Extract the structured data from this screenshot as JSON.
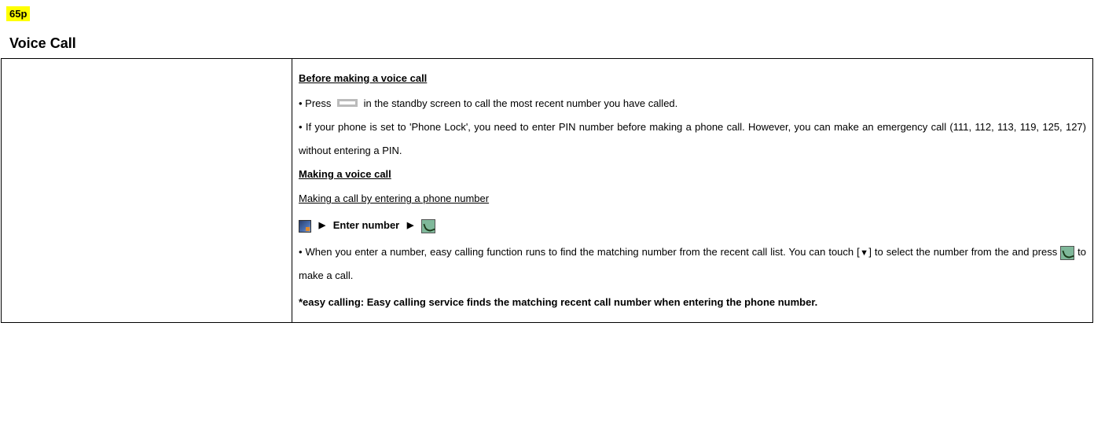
{
  "badge": "65p",
  "title": "Voice Call",
  "content": {
    "section1_header": "Before making a voice call",
    "bullet1_prefix": "• Press",
    "bullet1_suffix": "in the standby screen to call the most recent number you have called.",
    "bullet2": "• If your phone is set to 'Phone Lock', you need to enter PIN number before making a phone call. However, you can make an emergency call (111, 112, 113, 119, 125, 127) without entering a PIN.",
    "section2_header": "Making a voice call",
    "sub_header": "Making a call by entering a phone number",
    "step_arrow": "▶",
    "step_enter": "Enter number",
    "bullet3_prefix": "• When you enter a number, easy calling function runs to find the matching number from the recent call list. You can touch [",
    "down_triangle": "▼",
    "bullet3_mid": "] to select the number from the and press",
    "bullet3_suffix": "to make a call.",
    "footnote": "*easy calling: Easy calling service finds the matching recent call number when entering the phone number."
  }
}
